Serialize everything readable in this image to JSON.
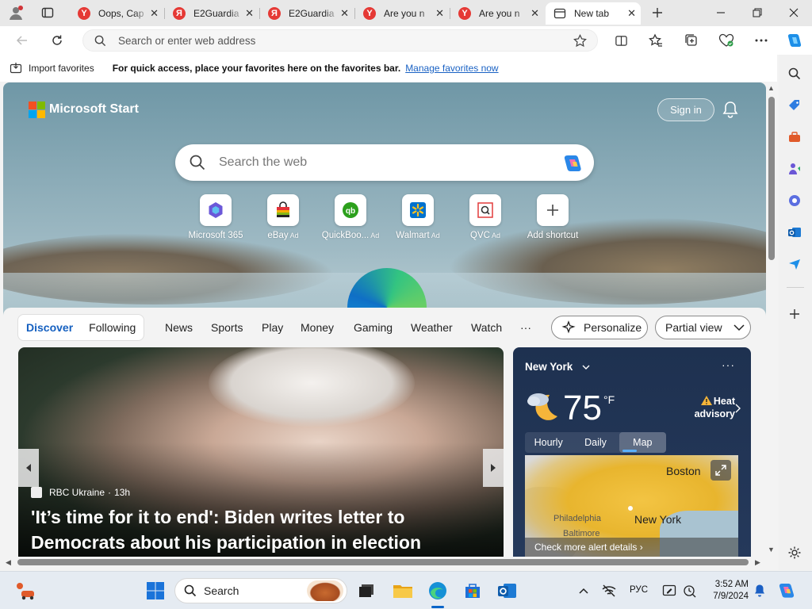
{
  "tabs": [
    {
      "label": "Oops, Cap",
      "favicon": "Y",
      "active": false
    },
    {
      "label": "E2Guardia",
      "favicon": "Я",
      "active": false
    },
    {
      "label": "E2Guardia",
      "favicon": "Я",
      "active": false
    },
    {
      "label": "Are you n",
      "favicon": "Y",
      "active": false
    },
    {
      "label": "Are you n",
      "favicon": "Y",
      "active": false
    },
    {
      "label": "New tab",
      "favicon": "newtab-icon",
      "active": true
    }
  ],
  "address_bar": {
    "placeholder": "Search or enter web address",
    "value": ""
  },
  "favorites_bar": {
    "import_label": "Import favorites",
    "message": "For quick access, place your favorites here on the favorites bar.",
    "manage_link": "Manage favorites now"
  },
  "page": {
    "brand": "Microsoft Start",
    "sign_in": "Sign in",
    "search_placeholder": "Search the web",
    "quick_links": [
      {
        "label": "Microsoft 365",
        "ad": ""
      },
      {
        "label": "eBay",
        "ad": "Ad"
      },
      {
        "label": "QuickBoo...",
        "ad": "Ad"
      },
      {
        "label": "Walmart",
        "ad": "Ad"
      },
      {
        "label": "QVC",
        "ad": "Ad"
      },
      {
        "label": "Add shortcut",
        "ad": ""
      }
    ]
  },
  "feed": {
    "tabs_primary": [
      "Discover",
      "Following"
    ],
    "tabs_secondary": [
      "News",
      "Sports",
      "Play",
      "Money",
      "Gaming",
      "Weather",
      "Watch"
    ],
    "more": "···",
    "personalize": "Personalize",
    "view_mode": "Partial view",
    "hero": {
      "source": "RBC Ukraine",
      "age": "13h",
      "title": "'It’s time for it to end': Biden writes letter to Democrats about his participation in election"
    },
    "weather": {
      "city": "New York",
      "temp": "75",
      "unit": "°F",
      "alert_line1": "Heat",
      "alert_line2": "advisory",
      "tabs": [
        "Hourly",
        "Daily",
        "Map"
      ],
      "selected_tab": "Map",
      "map_labels": {
        "boston": "Boston",
        "new_york": "New York",
        "philadelphia": "Philadelphia",
        "baltimore": "Baltimore"
      },
      "check_alerts": "Check more alert details"
    }
  },
  "taskbar": {
    "search_label": "Search",
    "language": "РУС",
    "time": "3:52 AM",
    "date": "7/9/2024"
  },
  "colors": {
    "accent": "#1560c0",
    "weather_bg": "#1e3150",
    "taskbar_bg": "#e5ebf2"
  }
}
